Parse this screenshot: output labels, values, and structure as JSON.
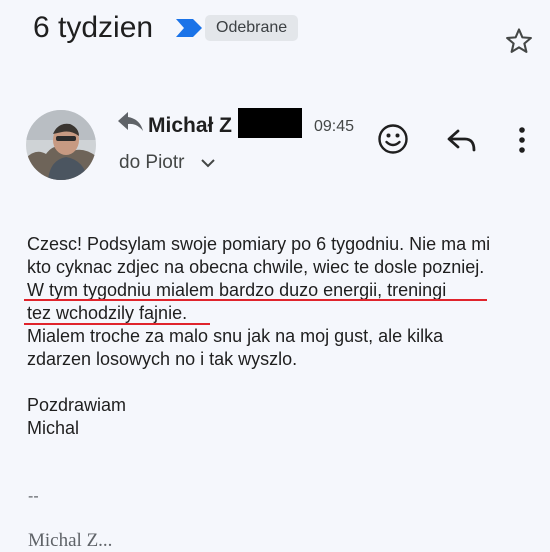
{
  "header": {
    "subject": "6 tydzien",
    "label": "Odebrane",
    "star_icon": "star-outline-icon"
  },
  "message": {
    "sender": "Michał Z",
    "time": "09:45",
    "recipient": "do Piotr",
    "body_lines": [
      "Czesc! Podsylam swoje pomiary po 6 tygodniu. Nie ma mi",
      "kto cyknac zdjec na obecna chwile, wiec te dosle pozniej.",
      "W tym tygodniu mialem bardzo duzo energii, treningi",
      "tez wchodzily fajnie.",
      "Mialem troche za malo snu jak na moj gust, ale kilka",
      "zdarzen losowych no i tak wyszlo."
    ],
    "closing": "Pozdrawiam",
    "name": "Michal",
    "signature_separator": "--",
    "signature_name": "Michal Z..."
  },
  "actions": {
    "emoji_icon": "emoji-smile-icon",
    "reply_icon": "reply-arrow-icon",
    "more_icon": "more-vert-icon"
  },
  "colors": {
    "background": "#f5f7fc",
    "importance_marker": "#1a73e8",
    "underline": "#e0242c",
    "label_chip": "#e3e6ea"
  }
}
